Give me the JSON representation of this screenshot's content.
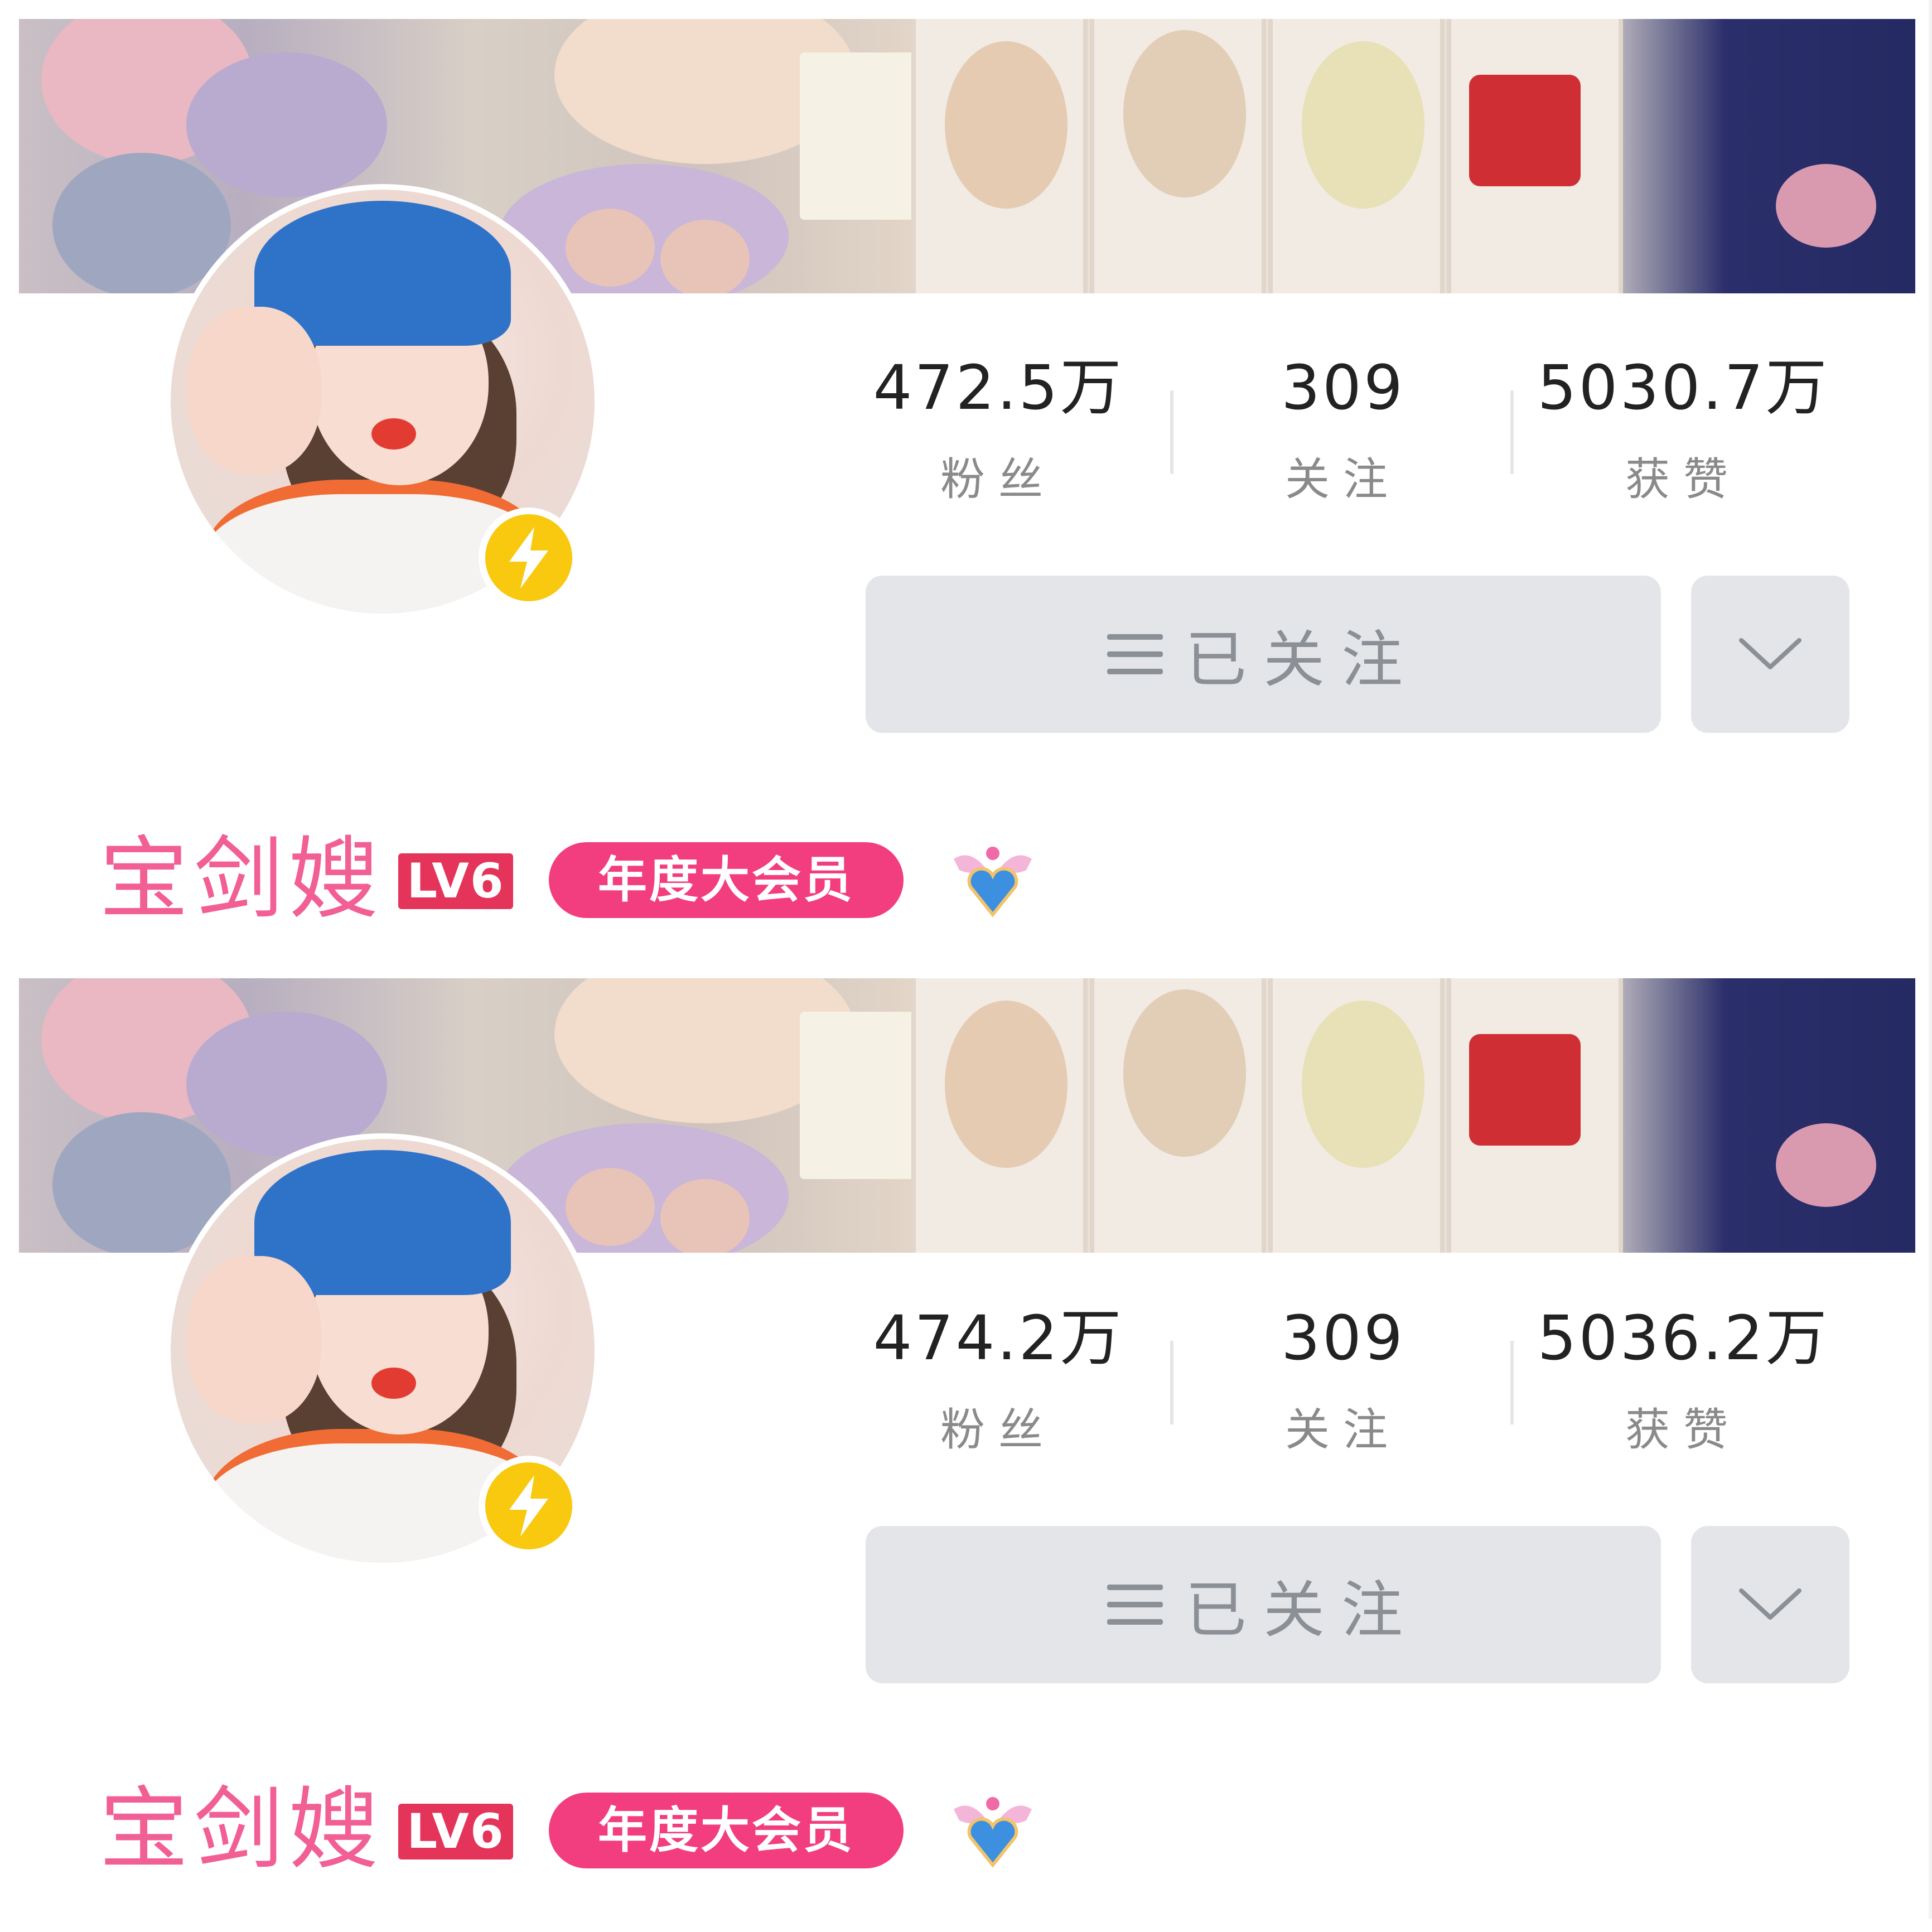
{
  "profiles": [
    {
      "stats": [
        {
          "value": "472.5万",
          "label": "粉丝"
        },
        {
          "value": "309",
          "label": "关注"
        },
        {
          "value": "5030.7万",
          "label": "获赞"
        }
      ],
      "follow_label": "已关注",
      "username": "宝剑嫂",
      "level_badge": "LV6",
      "vip_badge": "年度大会员"
    },
    {
      "stats": [
        {
          "value": "474.2万",
          "label": "粉丝"
        },
        {
          "value": "309",
          "label": "关注"
        },
        {
          "value": "5036.2万",
          "label": "获赞"
        }
      ],
      "follow_label": "已关注",
      "username": "宝剑嫂",
      "level_badge": "LV6",
      "vip_badge": "年度大会员"
    }
  ],
  "icons": {
    "menu": "menu-icon",
    "dropdown": "chevron-down-icon",
    "official": "lightning-bolt-icon",
    "pendant": "winged-heart-icon"
  },
  "colors": {
    "name": "#f15f95",
    "level_badge": "#e4345a",
    "vip_badge": "#f23d7e",
    "bolt": "#f8c90e",
    "button_bg": "#e3e5e8"
  }
}
